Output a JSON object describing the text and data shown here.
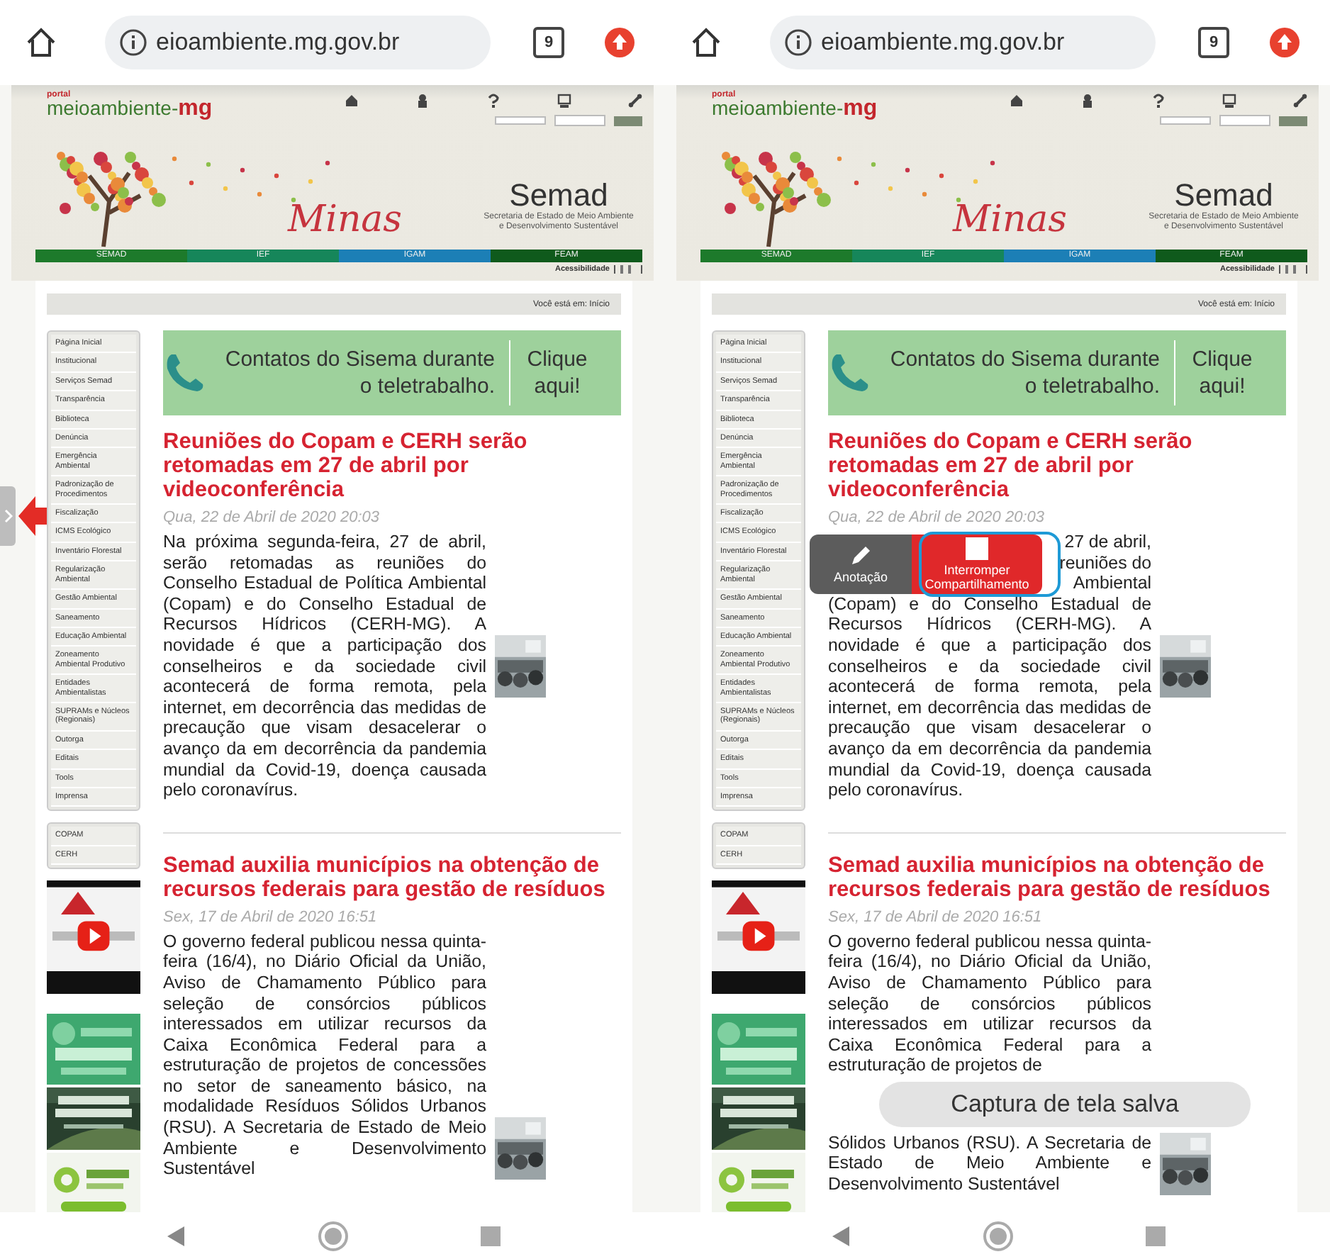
{
  "phones": [
    {
      "browser": {
        "url": "eioambiente.mg.gov.br",
        "tab_count": "9"
      },
      "site": {
        "portal": "portal",
        "logo": "meioambiente-",
        "logo_accent": "mg",
        "logo_script": "Minas",
        "title": "Semad",
        "subtitle": "Secretaria de Estado de Meio Ambiente e Desenvolvimento Sustentável",
        "tabs": [
          {
            "label": "SEMAD",
            "color": "#1d7a2b"
          },
          {
            "label": "IEF",
            "color": "#16865a"
          },
          {
            "label": "IGAM",
            "color": "#1c7fb6"
          },
          {
            "label": "FEAM",
            "color": "#0f5a1c"
          }
        ],
        "accessibility": "Acessibilidade",
        "breadcrumb": "Você está em: Início"
      },
      "menu": [
        {
          "label": "Página Inicial"
        },
        {
          "label": "Institucional"
        },
        {
          "label": "Serviços Semad"
        },
        {
          "label": "Transparência"
        },
        {
          "label": "Biblioteca"
        },
        {
          "label": "Denúncia"
        },
        {
          "label": "Emergência Ambiental"
        },
        {
          "label": "Padronização de Procedimentos"
        },
        {
          "label": "Fiscalização"
        },
        {
          "label": "ICMS Ecológico"
        },
        {
          "label": "Inventário Florestal"
        },
        {
          "label": "Regularização Ambiental"
        },
        {
          "label": "Gestão Ambiental"
        },
        {
          "label": "Saneamento"
        },
        {
          "label": "Educação Ambiental"
        },
        {
          "label": "Zoneamento Ambiental Produtivo"
        },
        {
          "label": "Entidades Ambientalistas"
        },
        {
          "label": "SUPRAMs e Núcleos (Regionais)"
        },
        {
          "label": "Outorga"
        },
        {
          "label": "Editais"
        },
        {
          "label": "Tools"
        },
        {
          "label": "Imprensa"
        }
      ],
      "menu_secondary": [
        {
          "label": "COPAM"
        },
        {
          "label": "CERH"
        }
      ],
      "banner": {
        "text": "Contatos do Sisema durante o teletrabalho.",
        "link": "Clique aqui!"
      },
      "articles": [
        {
          "title": "Reuniões do Copam e CERH serão retomadas em 27 de abril por videoconferência",
          "date": "Qua, 22 de Abril de 2020 20:03",
          "body": "Na próxima segunda-feira, 27 de abril, serão retomadas as reuniões do Conselho Estadual de Política Ambiental (Copam) e do Conselho Estadual de Recursos Hídricos (CERH-MG). A novidade é que a participação dos conselheiros e da sociedade civil acontecerá de forma remota, pela internet, em decorrência das medidas de precaução que visam desacelerar o avanço da em decorrência da pandemia mundial da Covid-19, doença causada pelo coronavírus."
        },
        {
          "title": "Semad auxilia municípios na obtenção de recursos federais para gestão de resíduos",
          "date": "Sex, 17 de Abril de 2020 16:51",
          "body": "O governo federal publicou nessa quinta-feira (16/4), no Diário Oficial da União, Aviso de Chamamento Público para seleção de consórcios públicos interessados em utilizar recursos da Caixa Econômica Federal para a estruturação de projetos de concessões no setor de saneamento básico, na modalidade Resíduos Sólidos Urbanos (RSU). A Secretaria de Estado de Meio Ambiente e Desenvolvimento Sustentável"
        }
      ],
      "overlay": {
        "kind": "edge_arrow"
      }
    },
    {
      "browser": {
        "url": "eioambiente.mg.gov.br",
        "tab_count": "9"
      },
      "site": {
        "portal": "portal",
        "logo": "meioambiente-",
        "logo_accent": "mg",
        "logo_script": "Minas",
        "title": "Semad",
        "subtitle": "Secretaria de Estado de Meio Ambiente e Desenvolvimento Sustentável",
        "tabs": [
          {
            "label": "SEMAD",
            "color": "#1d7a2b"
          },
          {
            "label": "IEF",
            "color": "#16865a"
          },
          {
            "label": "IGAM",
            "color": "#1c7fb6"
          },
          {
            "label": "FEAM",
            "color": "#0f5a1c"
          }
        ],
        "accessibility": "Acessibilidade",
        "breadcrumb": "Você está em: Início"
      },
      "menu": [
        {
          "label": "Página Inicial"
        },
        {
          "label": "Institucional"
        },
        {
          "label": "Serviços Semad"
        },
        {
          "label": "Transparência"
        },
        {
          "label": "Biblioteca"
        },
        {
          "label": "Denúncia"
        },
        {
          "label": "Emergência Ambiental"
        },
        {
          "label": "Padronização de Procedimentos"
        },
        {
          "label": "Fiscalização"
        },
        {
          "label": "ICMS Ecológico"
        },
        {
          "label": "Inventário Florestal"
        },
        {
          "label": "Regularização Ambiental"
        },
        {
          "label": "Gestão Ambiental"
        },
        {
          "label": "Saneamento"
        },
        {
          "label": "Educação Ambiental"
        },
        {
          "label": "Zoneamento Ambiental Produtivo"
        },
        {
          "label": "Entidades Ambientalistas"
        },
        {
          "label": "SUPRAMs e Núcleos (Regionais)"
        },
        {
          "label": "Outorga"
        },
        {
          "label": "Editais"
        },
        {
          "label": "Tools"
        },
        {
          "label": "Imprensa"
        }
      ],
      "menu_secondary": [
        {
          "label": "COPAM"
        },
        {
          "label": "CERH"
        }
      ],
      "banner": {
        "text": "Contatos do Sisema durante o teletrabalho.",
        "link": "Clique aqui!"
      },
      "articles": [
        {
          "title": "Reuniões do Copam e CERH serão retomadas em 27 de abril por videoconferência",
          "date": "Qua, 22 de Abril de 2020 20:03",
          "partial_lines": [
            "27 de abril,",
            "reuniões do",
            "Ambiental"
          ],
          "body": "(Copam) e do Conselho Estadual de Recursos Hídricos (CERH-MG). A novidade é que a participação dos conselheiros e da sociedade civil acontecerá de forma remota, pela internet, em decorrência das medidas de precaução que visam desacelerar o avanço da em decorrência da pandemia mundial da Covid-19, doença causada pelo coronavírus."
        },
        {
          "title": "Semad auxilia municípios na obtenção de recursos federais para gestão de resíduos",
          "date": "Sex, 17 de Abril de 2020 16:51",
          "body": "O governo federal publicou nessa quinta-feira (16/4), no Diário Oficial da União, Aviso de Chamamento Público para seleção de consórcios públicos interessados em utilizar recursos da Caixa Econômica Federal para a estruturação de projetos de",
          "body_after": "Sólidos Urbanos (RSU). A Secretaria de Estado de Meio Ambiente e Desenvolvimento Sustentável"
        }
      ],
      "overlay": {
        "kind": "share_toolbar",
        "buttons": [
          {
            "label": "Anotação",
            "kind": "annotate",
            "highlighted": false
          },
          {
            "label": "Interromper Compartilhamento",
            "kind": "stop",
            "highlighted": true
          }
        ],
        "toast": "Captura de tela salva"
      }
    }
  ]
}
